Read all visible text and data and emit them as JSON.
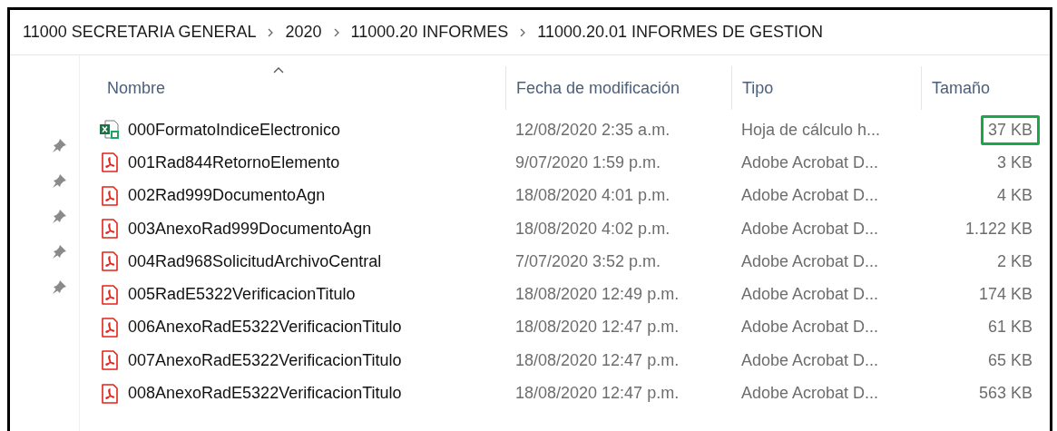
{
  "breadcrumb": [
    "11000 SECRETARIA GENERAL",
    "2020",
    "11000.20 INFORMES",
    "11000.20.01 INFORMES DE GESTION"
  ],
  "quick_access": [
    {
      "pinned": true
    },
    {
      "pinned": true
    },
    {
      "pinned": true
    },
    {
      "pinned": true
    },
    {
      "pinned": true
    }
  ],
  "columns": [
    {
      "label": "Nombre",
      "sorted": true
    },
    {
      "label": "Fecha de modificación",
      "sorted": false
    },
    {
      "label": "Tipo",
      "sorted": false
    },
    {
      "label": "Tamaño",
      "sorted": false
    }
  ],
  "files": [
    {
      "kind": "excel",
      "name": "000FormatoIndiceElectronico",
      "modified": "12/08/2020 2:35 a.m.",
      "type": "Hoja de cálculo h...",
      "size": "37 KB",
      "highlighted": true
    },
    {
      "kind": "pdf",
      "name": "001Rad844RetornoElemento",
      "modified": "9/07/2020 1:59 p.m.",
      "type": "Adobe Acrobat D...",
      "size": "3 KB",
      "highlighted": false
    },
    {
      "kind": "pdf",
      "name": "002Rad999DocumentoAgn",
      "modified": "18/08/2020 4:01 p.m.",
      "type": "Adobe Acrobat D...",
      "size": "4 KB",
      "highlighted": false
    },
    {
      "kind": "pdf",
      "name": "003AnexoRad999DocumentoAgn",
      "modified": "18/08/2020 4:02 p.m.",
      "type": "Adobe Acrobat D...",
      "size": "1.122 KB",
      "highlighted": false
    },
    {
      "kind": "pdf",
      "name": "004Rad968SolicitudArchivoCentral",
      "modified": "7/07/2020 3:52 p.m.",
      "type": "Adobe Acrobat D...",
      "size": "2 KB",
      "highlighted": false
    },
    {
      "kind": "pdf",
      "name": "005RadE5322VerificacionTitulo",
      "modified": "18/08/2020 12:49 p.m.",
      "type": "Adobe Acrobat D...",
      "size": "174 KB",
      "highlighted": false
    },
    {
      "kind": "pdf",
      "name": "006AnexoRadE5322VerificacionTitulo",
      "modified": "18/08/2020 12:47 p.m.",
      "type": "Adobe Acrobat D...",
      "size": "61 KB",
      "highlighted": false
    },
    {
      "kind": "pdf",
      "name": "007AnexoRadE5322VerificacionTitulo",
      "modified": "18/08/2020 12:47 p.m.",
      "type": "Adobe Acrobat D...",
      "size": "65 KB",
      "highlighted": false
    },
    {
      "kind": "pdf",
      "name": "008AnexoRadE5322VerificacionTitulo",
      "modified": "18/08/2020 12:47 p.m.",
      "type": "Adobe Acrobat D...",
      "size": "563 KB",
      "highlighted": false
    }
  ]
}
